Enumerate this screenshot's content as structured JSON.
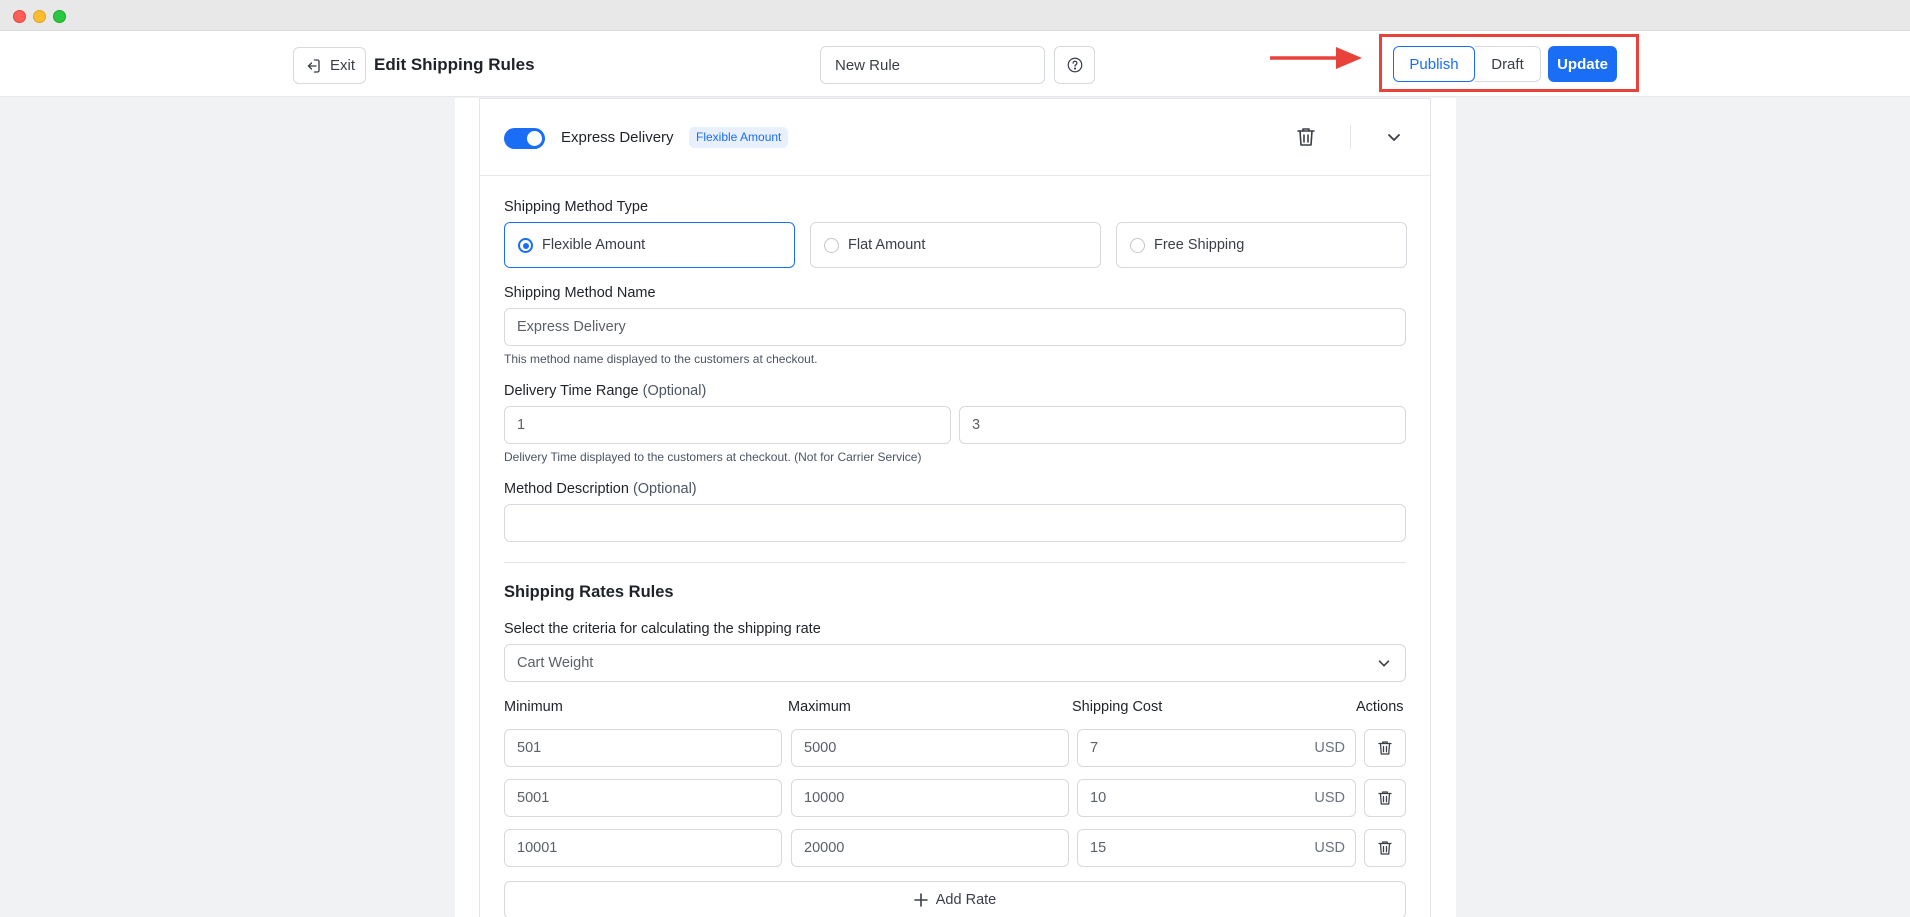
{
  "header": {
    "exit_label": "Exit",
    "title": "Edit Shipping Rules",
    "rule_name_value": "New Rule",
    "publish_label": "Publish",
    "draft_label": "Draft",
    "update_label": "Update"
  },
  "colors": {
    "accent": "#1a6ef5",
    "highlight": "#e8423a"
  },
  "shipping_method": {
    "enabled": true,
    "name": "Express Delivery",
    "badge": "Flexible Amount",
    "type_label": "Shipping Method Type",
    "types": [
      {
        "label": "Flexible Amount",
        "selected": true
      },
      {
        "label": "Flat Amount",
        "selected": false
      },
      {
        "label": "Free Shipping",
        "selected": false
      }
    ],
    "name_label": "Shipping Method Name",
    "name_value": "Express Delivery",
    "name_hint": "This method name displayed to the customers at checkout.",
    "delivery_label": "Delivery Time Range",
    "optional_text": "(Optional)",
    "delivery_min": "1",
    "delivery_max": "3",
    "delivery_hint": "Delivery Time displayed to the customers at checkout. (Not for Carrier Service)",
    "description_label": "Method Description",
    "description_value": ""
  },
  "rates": {
    "section_title": "Shipping Rates Rules",
    "criteria_label": "Select the criteria for calculating the shipping rate",
    "criteria_value": "Cart Weight",
    "columns": [
      "Minimum",
      "Maximum",
      "Shipping Cost",
      "Actions"
    ],
    "currency": "USD",
    "rows": [
      {
        "min": "501",
        "max": "5000",
        "cost": "7"
      },
      {
        "min": "5001",
        "max": "10000",
        "cost": "10"
      },
      {
        "min": "10001",
        "max": "20000",
        "cost": "15"
      }
    ],
    "add_label": "Add Rate"
  }
}
